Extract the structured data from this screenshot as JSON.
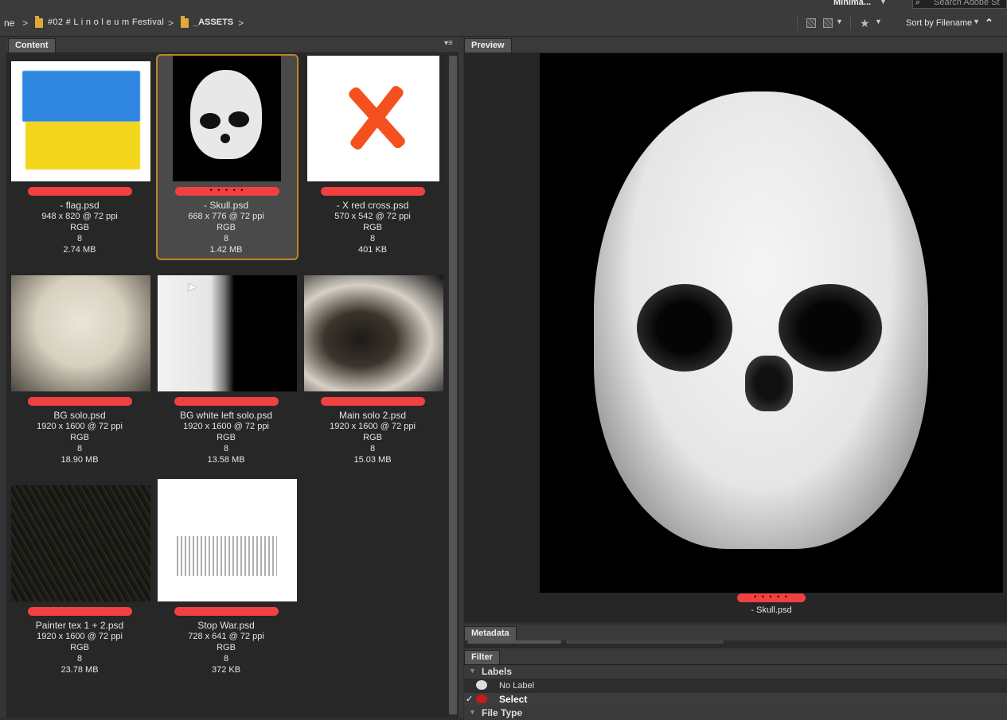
{
  "topbar": {
    "workspace_label": "Minima...",
    "search_placeholder": "Search Adobe St"
  },
  "breadcrumb": {
    "items": [
      "ne",
      "#02 # L i n o l e u m   Festival",
      "_ASSETS"
    ]
  },
  "toolbar": {
    "sort_label": "Sort by Filename"
  },
  "panels": {
    "content_tab": "Content",
    "preview_tab": "Preview",
    "metadata_tab": "Metadata",
    "filter_tab": "Filter"
  },
  "files": [
    {
      "name": "- flag.psd",
      "dims": "948 x 820 @ 72 ppi",
      "mode": "RGB",
      "bits": "8",
      "size": "2.74 MB",
      "rating": ""
    },
    {
      "name": "- Skull.psd",
      "dims": "668 x 776 @ 72 ppi",
      "mode": "RGB",
      "bits": "8",
      "size": "1.42 MB",
      "rating": "• • • • •"
    },
    {
      "name": "- X red cross.psd",
      "dims": "570 x 542 @ 72 ppi",
      "mode": "RGB",
      "bits": "8",
      "size": "401 KB",
      "rating": ""
    },
    {
      "name": "BG solo.psd",
      "dims": "1920 x 1600 @ 72 ppi",
      "mode": "RGB",
      "bits": "8",
      "size": "18.90 MB",
      "rating": ""
    },
    {
      "name": "BG white left solo.psd",
      "dims": "1920 x 1600 @ 72 ppi",
      "mode": "RGB",
      "bits": "8",
      "size": "13.58 MB",
      "rating": ""
    },
    {
      "name": "Main solo 2.psd",
      "dims": "1920 x 1600 @ 72 ppi",
      "mode": "RGB",
      "bits": "8",
      "size": "15.03 MB",
      "rating": ""
    },
    {
      "name": "Painter tex 1 + 2.psd",
      "dims": "1920 x 1600 @ 72 ppi",
      "mode": "RGB",
      "bits": "8",
      "size": "23.78 MB",
      "rating": ""
    },
    {
      "name": "Stop War.psd",
      "dims": "728 x 641 @ 72 ppi",
      "mode": "RGB",
      "bits": "8",
      "size": "372 KB",
      "rating": ""
    }
  ],
  "preview": {
    "filename": "- Skull.psd",
    "rating": "• • • • •"
  },
  "filter": {
    "labels_header": "Labels",
    "no_label": "No Label",
    "select": "Select",
    "file_type_header": "File Type"
  },
  "colors": {
    "label_red": "#f24040",
    "selection_border": "#b8862a",
    "folder": "#e2a83c"
  }
}
